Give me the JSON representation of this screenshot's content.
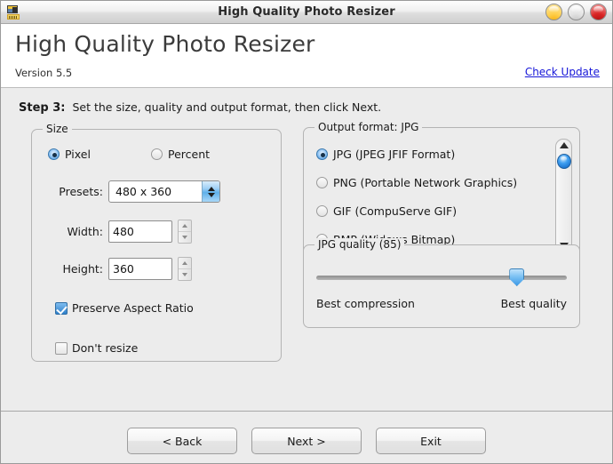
{
  "window": {
    "title": "High Quality Photo Resizer",
    "app_icon": "photo-resizer-icon",
    "controls": [
      {
        "name": "minimize-button",
        "icon": "minimize-icon",
        "color": "#ffcf4d"
      },
      {
        "name": "maximize-button",
        "icon": "maximize-icon",
        "color": "#e2e2e2"
      },
      {
        "name": "close-button",
        "icon": "close-icon",
        "color": "#d92626"
      }
    ]
  },
  "header": {
    "product_title": "High Quality Photo Resizer",
    "version": "Version 5.5",
    "check_update": "Check Update",
    "link_color": "#1616d8"
  },
  "step": {
    "label": "Step 3:",
    "description": "Set the size, quality and output format, then click Next."
  },
  "size_group": {
    "legend": "Size",
    "mode_options": [
      {
        "label": "Pixel",
        "selected": true
      },
      {
        "label": "Percent",
        "selected": false
      }
    ],
    "presets_label": "Presets:",
    "presets_value": "480 x 360",
    "width_label": "Width:",
    "width_value": "480",
    "height_label": "Height:",
    "height_value": "360",
    "preserve_aspect_label": "Preserve Aspect Ratio",
    "preserve_aspect_checked": true,
    "dont_resize_label": "Don't resize",
    "dont_resize_checked": false
  },
  "format_group": {
    "legend": "Output format: JPG",
    "options": [
      {
        "label": "JPG (JPEG JFIF Format)",
        "selected": true
      },
      {
        "label": "PNG (Portable Network Graphics)",
        "selected": false
      },
      {
        "label": "GIF (CompuServe GIF)",
        "selected": false
      },
      {
        "label": "BMP (Widows Bitmap)",
        "selected": false
      }
    ],
    "scrollbar": {
      "thumb_position_percent": 12
    }
  },
  "quality_group": {
    "legend": "JPG quality (85)",
    "value": 85,
    "min_label": "Best compression",
    "max_label": "Best quality",
    "thumb_position_percent": 82
  },
  "footer": {
    "back_label": "< Back",
    "next_label": "Next >",
    "exit_label": "Exit"
  }
}
